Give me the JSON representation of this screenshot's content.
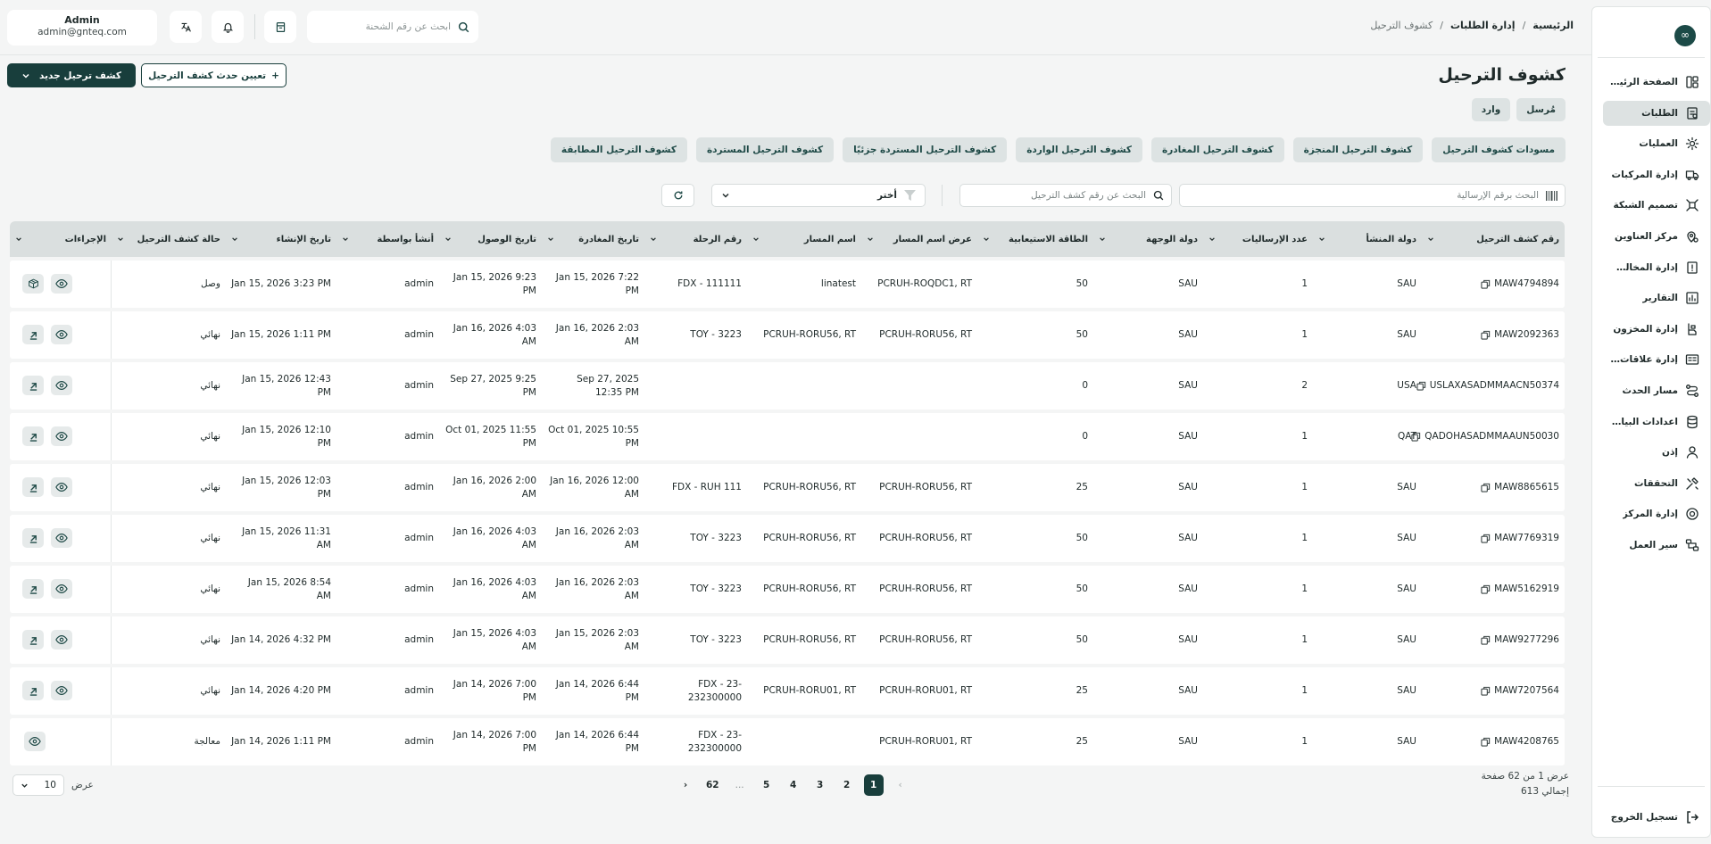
{
  "app": {
    "logo_glyph": "∞",
    "colors": {
      "primary": "#183e3c",
      "tab_bg": "#dde3e3",
      "header_bg": "#dadfdf",
      "page_bg": "#f4f5f5"
    }
  },
  "sidebar": {
    "items": [
      {
        "label": "الصفحة الرئيسية",
        "icon": "dashboard-icon"
      },
      {
        "label": "الطلبات",
        "icon": "orders-icon",
        "active": true
      },
      {
        "label": "العمليات",
        "icon": "operations-icon"
      },
      {
        "label": "إدارة المركبات",
        "icon": "truck-icon"
      },
      {
        "label": "تصميم الشبكة",
        "icon": "network-icon"
      },
      {
        "label": "مركز العناوين",
        "icon": "address-icon"
      },
      {
        "label": "إدارة المخالفات",
        "icon": "violation-icon"
      },
      {
        "label": "التقارير",
        "icon": "reports-icon"
      },
      {
        "label": "إدارة المخزون",
        "icon": "inventory-icon"
      },
      {
        "label": "إدارة علاقات العملاء",
        "icon": "crm-icon"
      },
      {
        "label": "مسار الحدث",
        "icon": "route-icon"
      },
      {
        "label": "اعدادات البيانات...",
        "icon": "database-icon"
      },
      {
        "label": "إذن",
        "icon": "permission-icon"
      },
      {
        "label": "التحققات",
        "icon": "tools-icon"
      },
      {
        "label": "إدارة المركز",
        "icon": "center-icon"
      },
      {
        "label": "سير العمل",
        "icon": "workflow-icon"
      }
    ],
    "logout": "تسجيل الخروج"
  },
  "header": {
    "breadcrumb": [
      "الرئيسية",
      "إدارة الطلبات",
      "كشوف الترحيل"
    ],
    "search_placeholder": "ابحث عن رقم الشحنة",
    "user_name": "Admin",
    "user_email": "admin@gnteq.com"
  },
  "page": {
    "title": "كشوف الترحيل",
    "new_button": "كشف ترحيل جديد",
    "assign_button": "تعيين حدث كشف الترحيل",
    "direction_pills": [
      "مُرسل",
      "وارد"
    ],
    "tabs": [
      "مسودات كشوف الترحيل",
      "كشوف الترحيل المنجزة",
      "كشوف الترحيل المغادرة",
      "كشوف الترحيل الواردة",
      "كشوف الترحيل المستردة جزئيًا",
      "كشوف الترحيل المستردة",
      "كشوف الترحيل المطابقة"
    ],
    "search_shipment_placeholder": "البحث برقم الإرسالية",
    "search_manifest_placeholder": "البحث عن رقم كشف الترحيل",
    "select_placeholder": "أختر"
  },
  "table": {
    "columns": [
      "رقم كشف الترحيل",
      "دولة المنشأ",
      "عدد الإرساليات",
      "دولة الوجهة",
      "الطاقة الاستيعابية",
      "عرض اسم المسار",
      "اسم المسار",
      "رقم الرحلة",
      "تاريخ المغادرة",
      "تاريخ الوصول",
      "أنشأ بواسطة",
      "تاريخ الإنشاء",
      "حالة كشف الترحيل",
      "الإجراءات"
    ],
    "rows": [
      [
        "MAW4794894",
        "SAU",
        "1",
        "SAU",
        "50",
        "PCRUH-ROQDC1, RT",
        "linatest",
        "FDX - 111111",
        "Jan 15, 2026 7:22 PM",
        "Jan 15, 2026 9:23 PM",
        "admin",
        "Jan 15, 2026 3:23 PM",
        "وصل"
      ],
      [
        "MAW2092363",
        "SAU",
        "1",
        "SAU",
        "50",
        "PCRUH-RORU56, RT",
        "PCRUH-RORU56, RT",
        "TOY - 3223",
        "Jan 16, 2026 2:03 AM",
        "Jan 16, 2026 4:03 AM",
        "admin",
        "Jan 15, 2026 1:11 PM",
        "نهائي"
      ],
      [
        "USLAXASADMMAACN50374",
        "USA",
        "2",
        "SAU",
        "0",
        "",
        "",
        "",
        "Sep 27, 2025 12:35 PM",
        "Sep 27, 2025 9:25 PM",
        "admin",
        "Jan 15, 2026 12:43 PM",
        "نهائي"
      ],
      [
        "QADOHASADMMAAUN50030",
        "QAT",
        "1",
        "SAU",
        "0",
        "",
        "",
        "",
        "Oct 01, 2025 10:55 PM",
        "Oct 01, 2025 11:55 PM",
        "admin",
        "Jan 15, 2026 12:10 PM",
        "نهائي"
      ],
      [
        "MAW8865615",
        "SAU",
        "1",
        "SAU",
        "25",
        "PCRUH-RORU56, RT",
        "PCRUH-RORU56, RT",
        "FDX - RUH 111",
        "Jan 16, 2026 12:00 AM",
        "Jan 16, 2026 2:00 AM",
        "admin",
        "Jan 15, 2026 12:03 PM",
        "نهائي"
      ],
      [
        "MAW7769319",
        "SAU",
        "1",
        "SAU",
        "50",
        "PCRUH-RORU56, RT",
        "PCRUH-RORU56, RT",
        "TOY - 3223",
        "Jan 16, 2026 2:03 AM",
        "Jan 16, 2026 4:03 AM",
        "admin",
        "Jan 15, 2026 11:31 AM",
        "نهائي"
      ],
      [
        "MAW5162919",
        "SAU",
        "1",
        "SAU",
        "50",
        "PCRUH-RORU56, RT",
        "PCRUH-RORU56, RT",
        "TOY - 3223",
        "Jan 16, 2026 2:03 AM",
        "Jan 16, 2026 4:03 AM",
        "admin",
        "Jan 15, 2026 8:54 AM",
        "نهائي"
      ],
      [
        "MAW9277296",
        "SAU",
        "1",
        "SAU",
        "50",
        "PCRUH-RORU56, RT",
        "PCRUH-RORU56, RT",
        "TOY - 3223",
        "Jan 15, 2026 2:03 AM",
        "Jan 15, 2026 4:03 AM",
        "admin",
        "Jan 14, 2026 4:32 PM",
        "نهائي"
      ],
      [
        "MAW7207564",
        "SAU",
        "1",
        "SAU",
        "25",
        "PCRUH-RORU01, RT",
        "PCRUH-RORU01, RT",
        "FDX - 23-232300000",
        "Jan 14, 2026 6:44 PM",
        "Jan 14, 2026 7:00 PM",
        "admin",
        "Jan 14, 2026 4:20 PM",
        "نهائي"
      ],
      [
        "MAW4208765",
        "SAU",
        "1",
        "SAU",
        "25",
        "PCRUH-RORU01, RT",
        "",
        "FDX - 23-232300000",
        "Jan 14, 2026 6:44 PM",
        "Jan 14, 2026 7:00 PM",
        "admin",
        "Jan 14, 2026 1:11 PM",
        "معالجة"
      ]
    ],
    "row_actions": [
      "receive",
      "view",
      "view",
      "view",
      "view",
      "view",
      "view",
      "view",
      "view",
      "none"
    ]
  },
  "pagination": {
    "info_line1": "عرض 1 من 62 صفحة",
    "info_line2": "إجمالي 613",
    "pages": [
      "1",
      "2",
      "3",
      "4",
      "5",
      "...",
      "62"
    ],
    "current": "1",
    "per_page_label": "عرض",
    "per_page_value": "10"
  }
}
